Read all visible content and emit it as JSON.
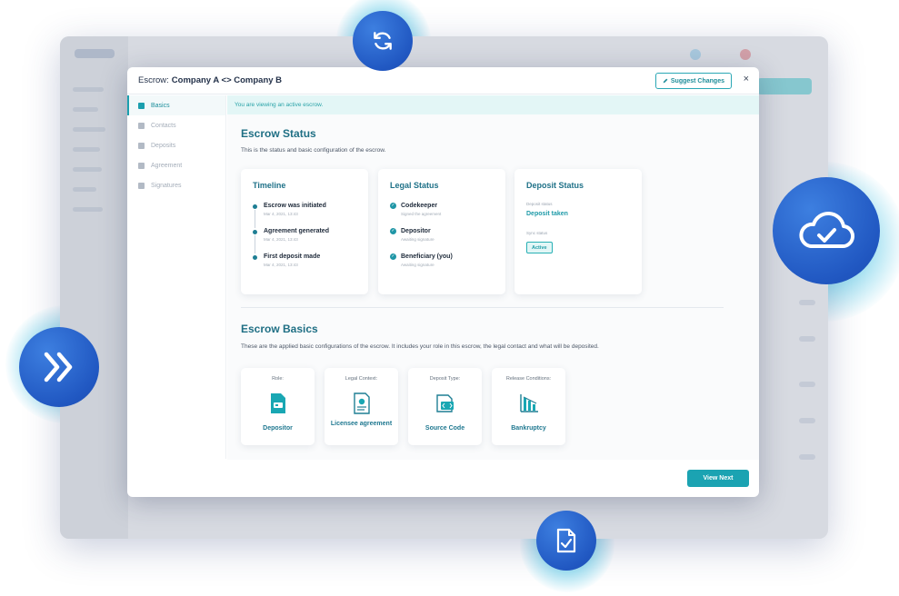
{
  "modal": {
    "title_prefix": "Escrow:",
    "title_bold": "Company A <> Company B",
    "suggest_label": "Suggest Changes",
    "close_label": "×",
    "view_next_label": "View Next"
  },
  "nav": [
    {
      "label": "Basics",
      "active": true
    },
    {
      "label": "Contacts",
      "active": false
    },
    {
      "label": "Deposits",
      "active": false
    },
    {
      "label": "Agreement",
      "active": false
    },
    {
      "label": "Signatures",
      "active": false
    }
  ],
  "banner": "You are viewing an active escrow.",
  "status": {
    "title": "Escrow Status",
    "desc": "This is the status and basic configuration of the escrow.",
    "timeline": {
      "title": "Timeline",
      "items": [
        {
          "label": "Escrow was initiated",
          "date": "Mar 4, 2021, 13:43"
        },
        {
          "label": "Agreement generated",
          "date": "Mar 4, 2021, 13:43"
        },
        {
          "label": "First deposit made",
          "date": "Mar 4, 2021, 13:43"
        }
      ]
    },
    "legal": {
      "title": "Legal Status",
      "items": [
        {
          "label": "Codekeeper",
          "sub": "Signed the agreement"
        },
        {
          "label": "Depositor",
          "sub": "Awaiting signature"
        },
        {
          "label": "Beneficiary (you)",
          "sub": "Awaiting signature"
        }
      ]
    },
    "deposit": {
      "title": "Deposit Status",
      "deposit_label": "Deposit status",
      "deposit_value": "Deposit taken",
      "sync_label": "Sync status",
      "sync_value": "Active"
    }
  },
  "basics": {
    "title": "Escrow Basics",
    "desc": "These are the applied basic configurations of the escrow. It includes your role in this escrow, the legal contact and what will be deposited.",
    "cards": [
      {
        "label": "Role:",
        "value": "Depositor",
        "icon": "depositor-icon"
      },
      {
        "label": "Legal Context:",
        "value": "Licensee agreement",
        "icon": "licensee-icon"
      },
      {
        "label": "Deposit Type:",
        "value": "Source Code",
        "icon": "source-code-icon"
      },
      {
        "label": "Release Conditions:",
        "value": "Bankruptcy",
        "icon": "bankruptcy-icon"
      }
    ]
  },
  "colors": {
    "accent": "#1ba3b2",
    "title": "#1f7188",
    "bubble": "#2158c2"
  }
}
